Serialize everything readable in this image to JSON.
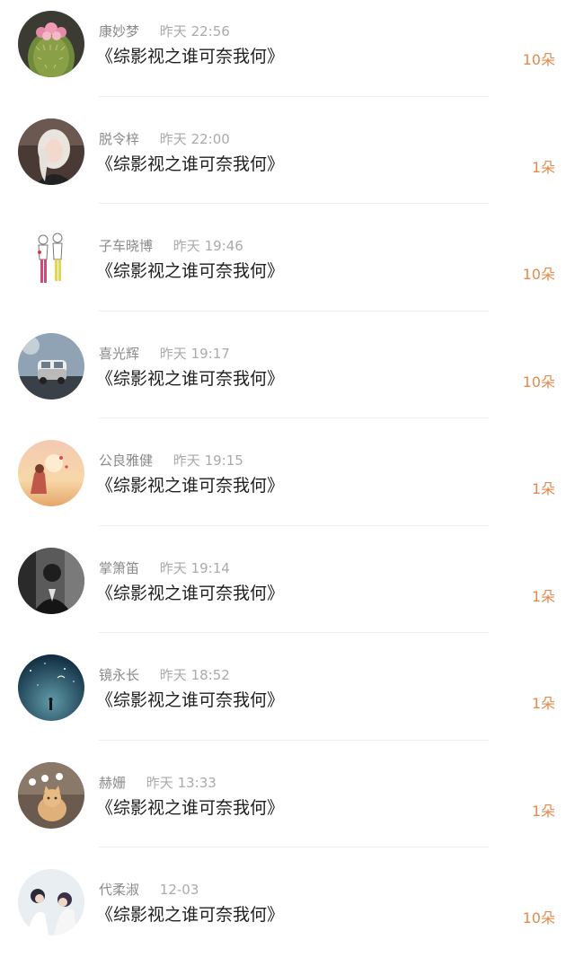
{
  "items": [
    {
      "name": "康妙梦",
      "time": "昨天 22:56",
      "title": "《综影视之谁可奈我何》",
      "count": "10朵",
      "avatar": "cactus-flower-icon"
    },
    {
      "name": "脱令梓",
      "time": "昨天 22:00",
      "title": "《综影视之谁可奈我何》",
      "count": "1朵",
      "avatar": "woman-portrait-icon"
    },
    {
      "name": "子车晓博",
      "time": "昨天 19:46",
      "title": "《综影视之谁可奈我何》",
      "count": "10朵",
      "avatar": "couple-drawing-icon"
    },
    {
      "name": "喜光辉",
      "time": "昨天 19:17",
      "title": "《综影视之谁可奈我何》",
      "count": "10朵",
      "avatar": "toy-van-icon"
    },
    {
      "name": "公良雅健",
      "time": "昨天 19:15",
      "title": "《综影视之谁可奈我何》",
      "count": "1朵",
      "avatar": "girl-sunset-icon"
    },
    {
      "name": "掌箫笛",
      "time": "昨天 19:14",
      "title": "《综影视之谁可奈我何》",
      "count": "1朵",
      "avatar": "man-suit-icon"
    },
    {
      "name": "镜永长",
      "time": "昨天 18:52",
      "title": "《综影视之谁可奈我何》",
      "count": "1朵",
      "avatar": "starry-night-icon"
    },
    {
      "name": "赫姗",
      "time": "昨天 13:33",
      "title": "《综影视之谁可奈我何》",
      "count": "1朵",
      "avatar": "question-cat-icon"
    },
    {
      "name": "代柔淑",
      "time": "12-03",
      "title": "《综影视之谁可奈我何》",
      "count": "10朵",
      "avatar": "girls-white-icon"
    }
  ],
  "colors": {
    "count": "#e38a4c",
    "name": "#8a8a8a",
    "time": "#aaaaaa",
    "title": "#1e1e1e"
  }
}
